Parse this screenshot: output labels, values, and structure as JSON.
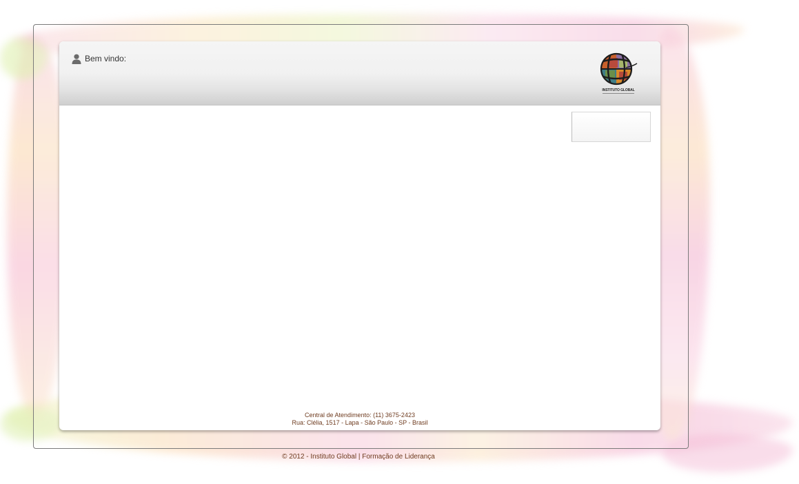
{
  "header": {
    "welcome_label": "Bem vindo:",
    "user_icon": "user-icon",
    "logo": {
      "icon": "globe-icon",
      "text": "INSTITUTO GLOBAL"
    }
  },
  "footer": {
    "contact_phone": "Central de Atendimento: (11) 3675-2423",
    "contact_address": "Rua: Clélia, 1517 - Lapa - São Paulo - SP - Brasil",
    "copyright": "© 2012 - Instituto Global | Formação de Liderança"
  },
  "colors": {
    "footer_text": "#6e3b1f",
    "header_gradient_top": "#f5f5f5",
    "header_gradient_bottom": "#cfcfcf"
  }
}
